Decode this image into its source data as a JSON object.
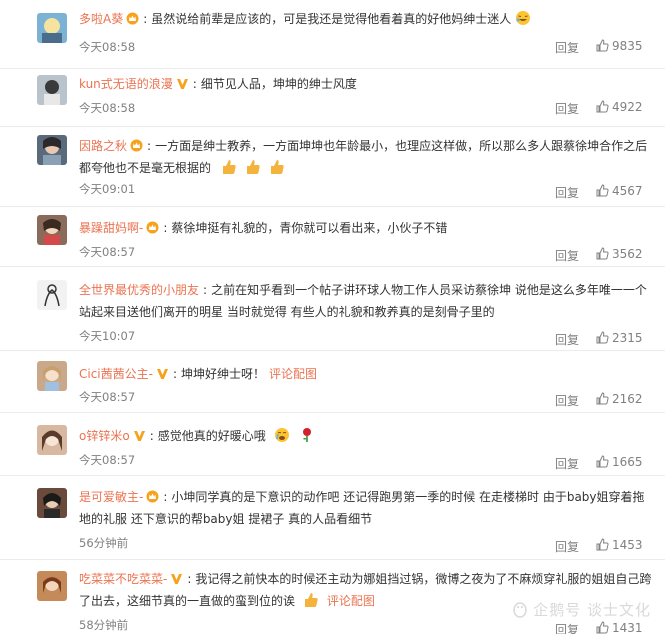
{
  "comments": [
    {
      "user": "多啦A葵",
      "badge": "crown",
      "text": "虽然说给前辈是应该的，可是我还是觉得他看着真的好他妈绅士迷人",
      "emoji": "laugh-cry",
      "time": "今天08:58",
      "reply": "回复",
      "likes": "9835",
      "avatar": "#7cb3d4"
    },
    {
      "user": "kun式无语的浪漫",
      "badge": "v",
      "text": "细节见人品，坤坤的绅士风度",
      "time": "今天08:58",
      "reply": "回复",
      "likes": "4922",
      "avatar": "#b9c3cc"
    },
    {
      "user": "因路之秋",
      "badge": "crown",
      "text": "一方面是绅士教养，一方面坤坤也年龄最小，也理应这样做，所以那么多人跟蔡徐坤合作之后都夸他也不是毫无根据的",
      "emoji": "thumbs-3",
      "time": "今天09:01",
      "reply": "回复",
      "likes": "4567",
      "avatar": "#5a6a7a"
    },
    {
      "user": "暴躁甜妈啊-",
      "badge": "crown",
      "text": "蔡徐坤挺有礼貌的，青你就可以看出来，小伙子不错",
      "time": "今天08:57",
      "reply": "回复",
      "likes": "3562",
      "avatar": "#8a6a5a"
    },
    {
      "user": "全世界最优秀的小朋友",
      "badge": "",
      "text": "之前在知乎看到一个帖子讲环球人物工作人员采访蔡徐坤 说他是这么多年唯一一个站起来目送他们离开的明星 当时就觉得 有些人的礼貌和教养真的是刻骨子里的",
      "time": "今天10:07",
      "reply": "回复",
      "likes": "2315",
      "avatar": "#e8e8e8"
    },
    {
      "user": "Cici茜茜公主-",
      "badge": "v",
      "text": "坤坤好绅士呀！",
      "link": "评论配图",
      "time": "今天08:57",
      "reply": "回复",
      "likes": "2162",
      "avatar": "#c9a98a"
    },
    {
      "user": "o锌锌米o",
      "badge": "v",
      "text": "感觉他真的好暖心哦",
      "emoji": "tears-rose",
      "time": "今天08:57",
      "reply": "回复",
      "likes": "1665",
      "avatar": "#d8b8a0"
    },
    {
      "user": "是可爱敏主-",
      "badge": "crown",
      "text": "小坤同学真的是下意识的动作吧 还记得跑男第一季的时候 在走楼梯时 由于baby姐穿着拖地的礼服 还下意识的帮baby姐 提裙子 真的人品看细节",
      "time": "56分钟前",
      "reply": "回复",
      "likes": "1453",
      "avatar": "#6a4a3a"
    },
    {
      "user": "吃菜菜不吃菜菜-",
      "badge": "v",
      "text": "我记得之前快本的时候还主动为娜姐挡过锅，微博之夜为了不麻烦穿礼服的姐姐自己跨了出去，这细节真的一直做的蛮到位的诶",
      "emoji": "thumb",
      "link": "评论配图",
      "time": "58分钟前",
      "reply": "回复",
      "likes": "1431",
      "avatar": "#c48a5a"
    }
  ],
  "watermark": "企鹅号 谈士文化",
  "colors": {
    "username": "#eb7350",
    "meta": "#808080",
    "badge": "#f7a21d"
  }
}
